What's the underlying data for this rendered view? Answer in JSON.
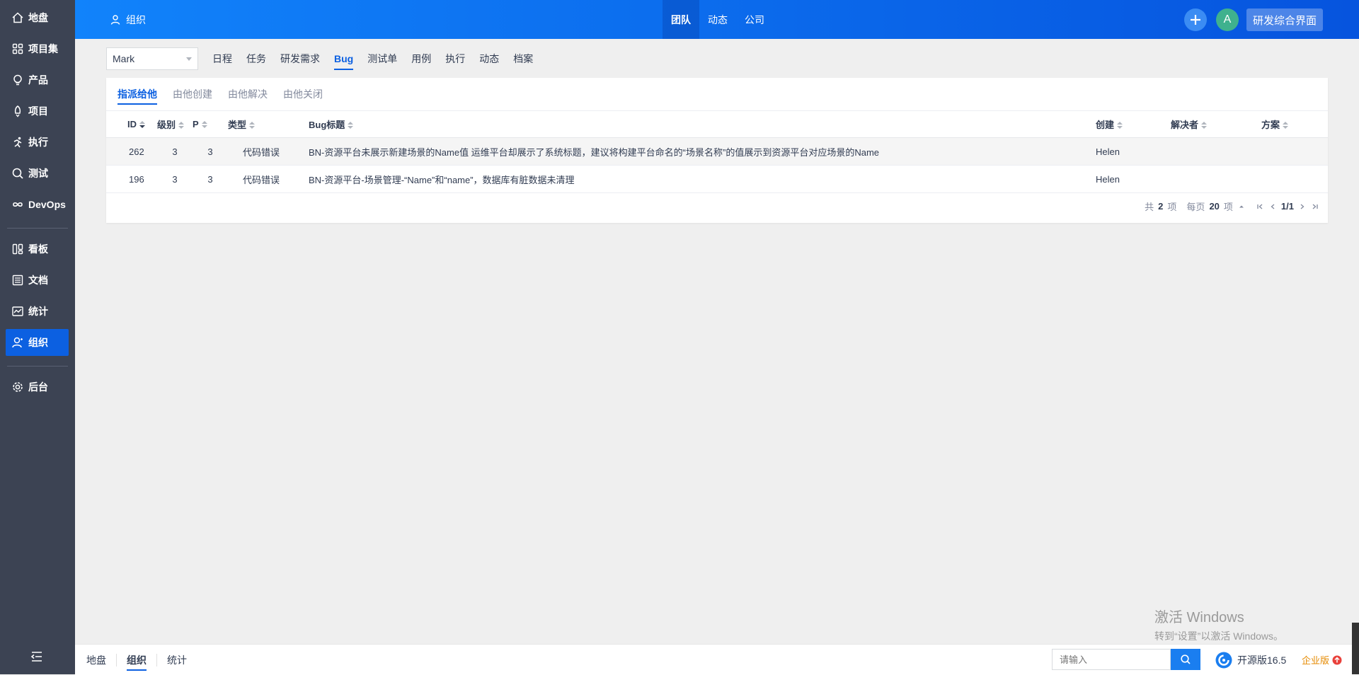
{
  "sidebar": {
    "items": [
      {
        "label": "地盘",
        "icon": "home-icon"
      },
      {
        "label": "项目集",
        "icon": "grid-icon"
      },
      {
        "label": "产品",
        "icon": "lightbulb-icon"
      },
      {
        "label": "项目",
        "icon": "rocket-icon"
      },
      {
        "label": "执行",
        "icon": "running-icon"
      },
      {
        "label": "测试",
        "icon": "magnifier-icon"
      },
      {
        "label": "DevOps",
        "icon": "infinity-icon"
      },
      {
        "label": "看板",
        "icon": "kanban-icon"
      },
      {
        "label": "文档",
        "icon": "document-icon"
      },
      {
        "label": "统计",
        "icon": "chart-icon"
      },
      {
        "label": "组织",
        "icon": "user-icon"
      },
      {
        "label": "后台",
        "icon": "gear-icon"
      }
    ],
    "active": "组织"
  },
  "header": {
    "module": "组织",
    "nav": [
      "团队",
      "动态",
      "公司"
    ],
    "active_nav": "团队",
    "avatar_letter": "A",
    "ui_switch": "研发综合界面",
    "accent": "#0c60e1"
  },
  "subnav": {
    "user_select": "Mark",
    "items": [
      "日程",
      "任务",
      "研发需求",
      "Bug",
      "测试单",
      "用例",
      "执行",
      "动态",
      "档案"
    ],
    "active": "Bug"
  },
  "tabs": {
    "items": [
      "指派给他",
      "由他创建",
      "由他解决",
      "由他关闭"
    ],
    "active": "指派给他"
  },
  "table": {
    "columns": {
      "id": "ID",
      "severity": "级别",
      "pri": "P",
      "type": "类型",
      "title": "Bug标题",
      "creator": "创建",
      "resolver": "解决者",
      "resolution": "方案"
    },
    "rows": [
      {
        "id": "262",
        "severity": "3",
        "pri": "3",
        "type": "代码错误",
        "title": "BN-资源平台未展示新建场景的Name值 运维平台却展示了系统标题，建议将构建平台命名的“场景名称”的值展示到资源平台对应场景的Name",
        "creator": "Helen",
        "resolver": "",
        "resolution": ""
      },
      {
        "id": "196",
        "severity": "3",
        "pri": "3",
        "type": "代码错误",
        "title": "BN-资源平台-场景管理-“Name”和“name”，数据库有脏数据未清理",
        "creator": "Helen",
        "resolver": "",
        "resolution": ""
      }
    ]
  },
  "pager": {
    "total_prefix": "共",
    "total": "2",
    "total_suffix": "项",
    "per_page_prefix": "每页",
    "per_page": "20",
    "per_page_suffix": "项",
    "page": "1/1"
  },
  "watermark": {
    "line1": "激活 Windows",
    "line2": "转到“设置”以激活 Windows。"
  },
  "footer": {
    "breadcrumbs": [
      "地盘",
      "组织",
      "统计"
    ],
    "active": "组织",
    "search_placeholder": "请输入",
    "version": "开源版16.5",
    "enterprise": "企业版"
  }
}
